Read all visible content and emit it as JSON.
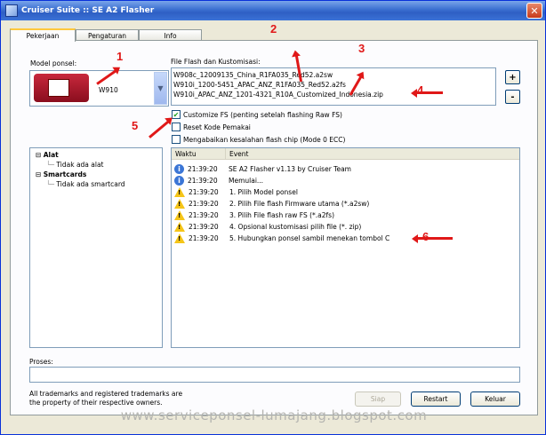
{
  "window": {
    "title": "Cruiser Suite :: SE A2 Flasher",
    "close": "✕"
  },
  "tabs": [
    {
      "label": "Pekerjaan",
      "active": true
    },
    {
      "label": "Pengaturan",
      "active": false
    },
    {
      "label": "Info",
      "active": false
    }
  ],
  "model": {
    "label": "Model ponsel:",
    "value": "W910",
    "dropdown_icon": "chevron-down-icon"
  },
  "flash_files": {
    "label": "File Flash dan Kustomisasi:",
    "items": [
      "W908c_12009135_China_R1FA035_Red52.a2sw",
      "W910i_1200-5451_APAC_ANZ_R1FA035_Red52.a2fs",
      "W910i_APAC_ANZ_1201-4321_R10A_Customized_Indonesia.zip"
    ],
    "add_label": "+",
    "remove_label": "-"
  },
  "options": [
    {
      "label": "Customize FS (penting setelah flashing Raw FS)",
      "checked": true
    },
    {
      "label": "Reset Kode Pemakai",
      "checked": false
    },
    {
      "label": "Mengabaikan kesalahan flash chip (Mode 0 ECC)",
      "checked": false
    }
  ],
  "tree": {
    "alat": {
      "label": "Alat",
      "child": "Tidak ada alat"
    },
    "smartcards": {
      "label": "Smartcards",
      "child": "Tidak ada smartcard"
    },
    "expand_icon": "⊟"
  },
  "log": {
    "columns": [
      "Waktu",
      "Event"
    ],
    "rows": [
      {
        "type": "info",
        "time": "21:39:20",
        "event": "SE A2 Flasher v1.13 by Cruiser Team"
      },
      {
        "type": "info",
        "time": "21:39:20",
        "event": "Memulai..."
      },
      {
        "type": "warn",
        "time": "21:39:20",
        "event": "1. Pilih Model ponsel"
      },
      {
        "type": "warn",
        "time": "21:39:20",
        "event": "2. Pilih File flash Firmware utama (*.a2sw)"
      },
      {
        "type": "warn",
        "time": "21:39:20",
        "event": "3. Pilih File flash raw FS (*.a2fs)"
      },
      {
        "type": "warn",
        "time": "21:39:20",
        "event": "4. Opsional kustomisasi pilih file (*. zip)"
      },
      {
        "type": "warn",
        "time": "21:39:20",
        "event": "5. Hubungkan ponsel sambil menekan tombol C"
      }
    ]
  },
  "progress": {
    "label": "Proses:",
    "value": 0
  },
  "footer": {
    "trademark_line1": "All trademarks and registered trademarks are",
    "trademark_line2": "the property of their respective owners.",
    "siap": "Siap",
    "restart": "Restart",
    "keluar": "Keluar"
  },
  "annotations": [
    "1",
    "2",
    "3",
    "4",
    "5",
    "6"
  ],
  "annotation_color": "#e01818",
  "watermark": "www.serviceponsel-lumajang.blogspot.com"
}
